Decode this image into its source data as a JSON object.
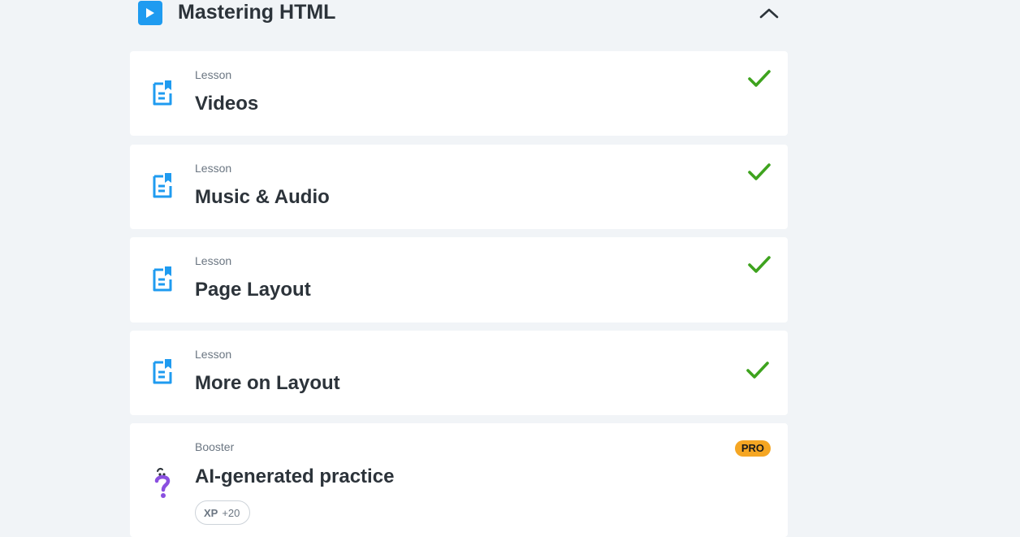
{
  "module": {
    "title": "Mastering HTML",
    "icon": "play-icon",
    "collapse_icon": "chevron-up-icon"
  },
  "lessons": [
    {
      "kind": "Lesson",
      "title": "Videos",
      "icon": "lesson-document-icon",
      "completed": true
    },
    {
      "kind": "Lesson",
      "title": "Music & Audio",
      "icon": "lesson-document-icon",
      "completed": true
    },
    {
      "kind": "Lesson",
      "title": "Page Layout",
      "icon": "lesson-document-icon",
      "completed": true
    },
    {
      "kind": "Lesson",
      "title": "More on Layout",
      "icon": "lesson-document-icon",
      "completed": true
    }
  ],
  "booster": {
    "kind": "Booster",
    "title": "AI-generated practice",
    "icon": "question-mark-icon",
    "badge": "PRO",
    "xp_label": "XP",
    "xp_value": "+20"
  },
  "colors": {
    "accent": "#1f9bf0",
    "check": "#3ea31e",
    "pro": "#f5a623",
    "booster": "#8a4fe0",
    "background": "#f1f4f7"
  }
}
